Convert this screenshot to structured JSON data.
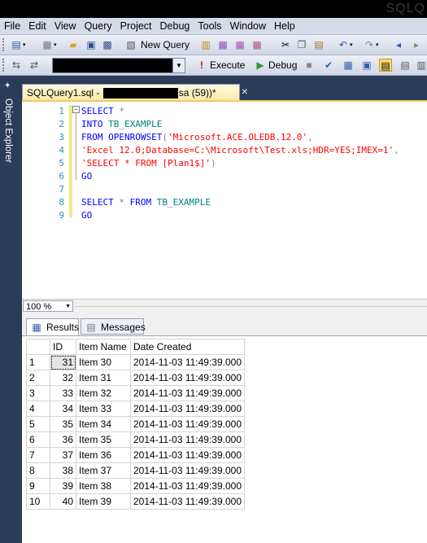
{
  "window": {
    "title": "SQLQ"
  },
  "menu": [
    "File",
    "Edit",
    "View",
    "Query",
    "Project",
    "Debug",
    "Tools",
    "Window",
    "Help"
  ],
  "toolbar": {
    "new_query": "New Query"
  },
  "toolbar2": {
    "execute": "Execute",
    "debug": "Debug"
  },
  "side_panel": {
    "label": "Object Explorer"
  },
  "document_tab": {
    "name": "SQLQuery1.sql - ",
    "suffix": "sa (59))*"
  },
  "editor": {
    "line_numbers": [
      "1",
      "2",
      "3",
      "4",
      "5",
      "6",
      "7",
      "8",
      "9"
    ]
  },
  "zoom": {
    "value": "100 %"
  },
  "result_tabs": {
    "results": "Results",
    "messages": "Messages"
  },
  "grid": {
    "columns": [
      "ID",
      "Item Name",
      "Date Created"
    ],
    "rows": [
      [
        "1",
        "31",
        "Item 30",
        "2014-11-03 11:49:39.000"
      ],
      [
        "2",
        "32",
        "Item 31",
        "2014-11-03 11:49:39.000"
      ],
      [
        "3",
        "33",
        "Item 32",
        "2014-11-03 11:49:39.000"
      ],
      [
        "4",
        "34",
        "Item 33",
        "2014-11-03 11:49:39.000"
      ],
      [
        "5",
        "35",
        "Item 34",
        "2014-11-03 11:49:39.000"
      ],
      [
        "6",
        "36",
        "Item 35",
        "2014-11-03 11:49:39.000"
      ],
      [
        "7",
        "37",
        "Item 36",
        "2014-11-03 11:49:39.000"
      ],
      [
        "8",
        "38",
        "Item 37",
        "2014-11-03 11:49:39.000"
      ],
      [
        "9",
        "39",
        "Item 38",
        "2014-11-03 11:49:39.000"
      ],
      [
        "10",
        "40",
        "Item 39",
        "2014-11-03 11:49:39.000"
      ]
    ]
  }
}
